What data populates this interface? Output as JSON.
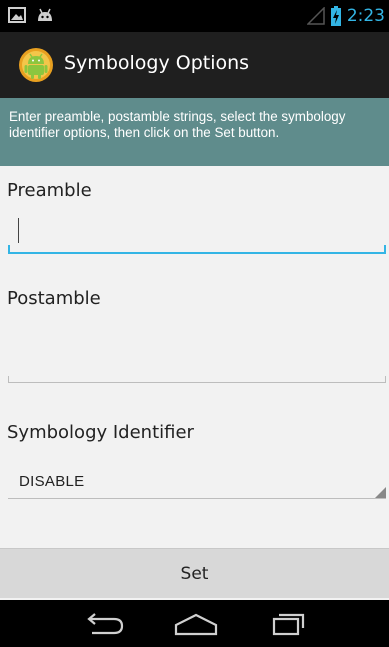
{
  "status_bar": {
    "time": "2:23",
    "left_icons": [
      "picture-icon",
      "android-debug-icon"
    ],
    "right_icons": [
      "signal-icon",
      "battery-charging-icon"
    ],
    "accent_color": "#33b5e5"
  },
  "action_bar": {
    "title": "Symbology Options",
    "icon": "android-robot-icon"
  },
  "instructions": {
    "text": "Enter preamble, postamble strings, select the symbology identifier options, then click on the Set button.",
    "background_color": "#5f8c8c"
  },
  "form": {
    "preamble_label": "Preamble",
    "preamble_value": "",
    "postamble_label": "Postamble",
    "postamble_value": "",
    "symbology_identifier_label": "Symbology Identifier",
    "symbology_identifier_selected": "DISABLE"
  },
  "buttons": {
    "set_label": "Set"
  },
  "nav_bar": {
    "icons": [
      "back-icon",
      "home-icon",
      "recent-apps-icon"
    ]
  }
}
